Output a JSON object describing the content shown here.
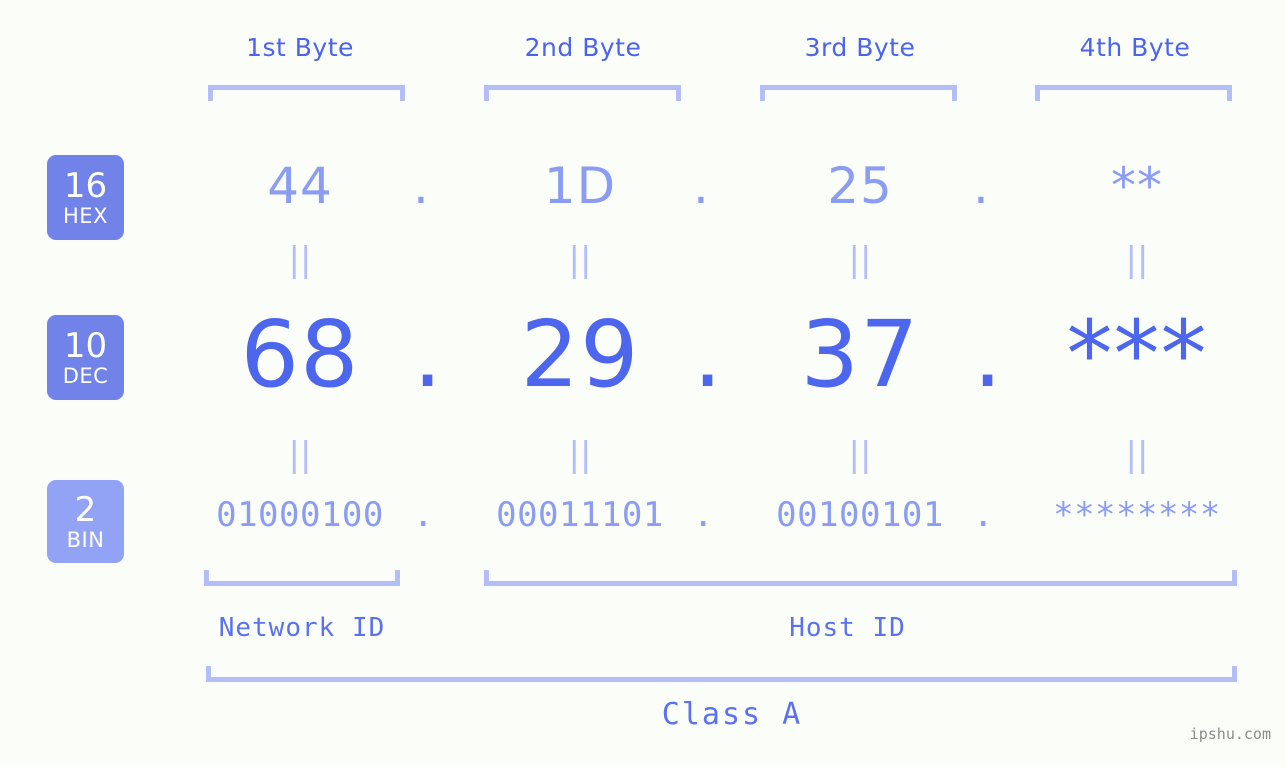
{
  "watermark": "ipshu.com",
  "byte_headers": [
    {
      "label": "1st Byte"
    },
    {
      "label": "2nd Byte"
    },
    {
      "label": "3rd Byte"
    },
    {
      "label": "4th Byte"
    }
  ],
  "radix_badges": [
    {
      "number": "16",
      "name": "HEX"
    },
    {
      "number": "10",
      "name": "DEC"
    },
    {
      "number": "2",
      "name": "BIN"
    }
  ],
  "separator": ".",
  "equals_mark": "||",
  "rows": {
    "hex": {
      "values": [
        "44",
        "1D",
        "25",
        "**"
      ]
    },
    "dec": {
      "values": [
        "68",
        "29",
        "37",
        "***"
      ]
    },
    "bin": {
      "values": [
        "01000100",
        "00011101",
        "00100101",
        "********"
      ]
    }
  },
  "sections": [
    {
      "label": "Network ID"
    },
    {
      "label": "Host ID"
    }
  ],
  "class": {
    "label": "Class A"
  },
  "colors": {
    "background": "#fbfdf9",
    "accent_strong": "#4d66ee",
    "accent_light": "#8b9cf3",
    "bracket": "#b3bdf7",
    "badge_dark": "#7183e8",
    "badge_light": "#92a3f6",
    "watermark": "#8c8c8c"
  }
}
